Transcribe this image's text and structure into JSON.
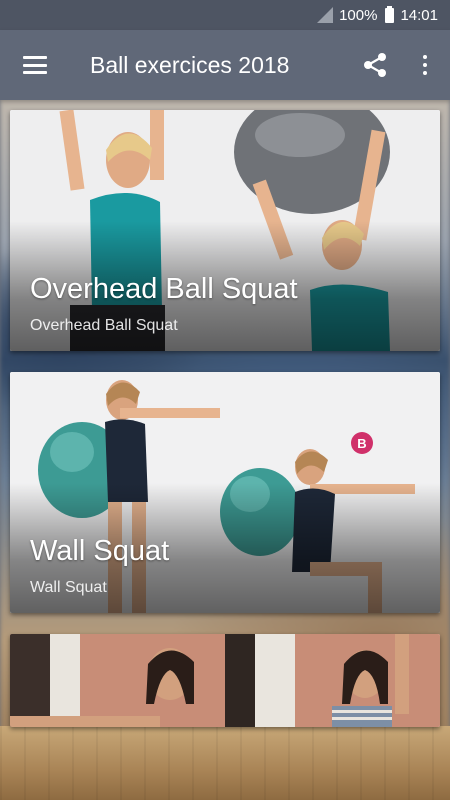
{
  "status_bar": {
    "battery": "100%",
    "time": "14:01"
  },
  "app_bar": {
    "title": "Ball exercices 2018"
  },
  "cards": [
    {
      "title": "Overhead Ball Squat",
      "subtitle": "Overhead Ball Squat"
    },
    {
      "title": "Wall Squat",
      "subtitle": "Wall Squat"
    },
    {
      "title": "",
      "subtitle": ""
    }
  ],
  "icons": {
    "menu": "hamburger-menu-icon",
    "share": "share-icon",
    "more": "more-vert-icon",
    "signal": "signal-icon",
    "battery": "battery-icon"
  },
  "colors": {
    "status_bar": "#4e5563",
    "app_bar": "#606878",
    "ball_gray": "#6f7277",
    "ball_teal": "#3d9b94",
    "top_teal": "#1a9aa0",
    "badge": "#d0306a"
  },
  "badge_text": "B"
}
